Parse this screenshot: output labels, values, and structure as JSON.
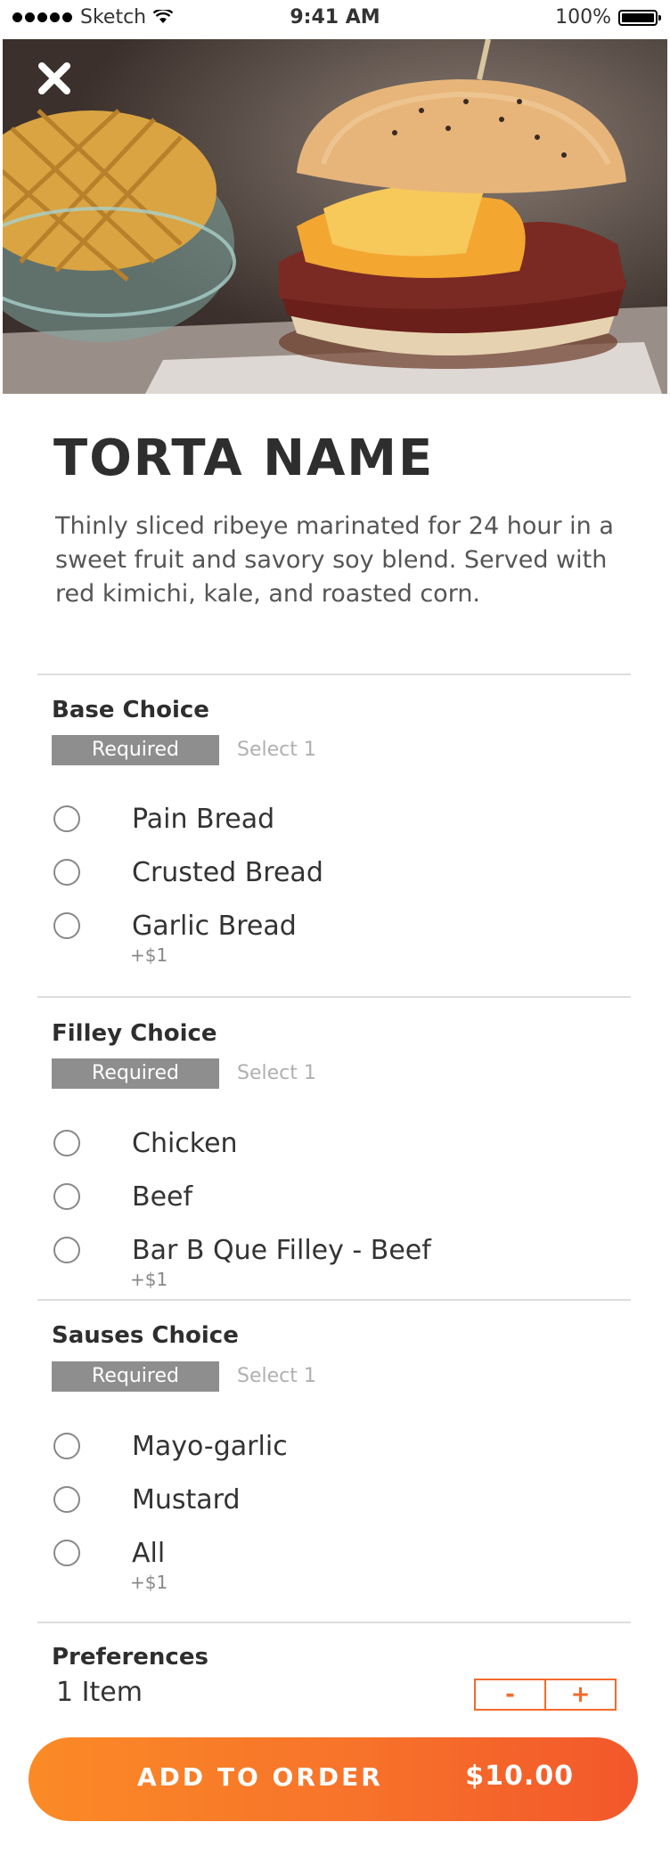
{
  "status_bar": {
    "carrier": "Sketch",
    "time": "9:41 AM",
    "battery": "100%"
  },
  "item": {
    "title": "TORTA NAME",
    "description": "Thinly sliced ribeye marinated for 24 hour in a sweet fruit and savory soy blend. Served with red kimichi, kale, and roasted corn."
  },
  "groups": [
    {
      "title": "Base Choice",
      "badge": "Required",
      "hint": "Select 1",
      "options": [
        {
          "label": "Pain Bread"
        },
        {
          "label": "Crusted Bread"
        },
        {
          "label": "Garlic Bread",
          "price": "+$1"
        }
      ]
    },
    {
      "title": "Filley Choice",
      "badge": "Required",
      "hint": "Select 1",
      "options": [
        {
          "label": "Chicken"
        },
        {
          "label": "Beef"
        },
        {
          "label": "Bar B Que Filley - Beef",
          "price": "+$1"
        }
      ]
    },
    {
      "title": "Sauses Choice",
      "badge": "Required",
      "hint": "Select 1",
      "options": [
        {
          "label": "Mayo-garlic"
        },
        {
          "label": "Mustard"
        },
        {
          "label": "All",
          "price": "+$1"
        }
      ]
    }
  ],
  "preferences": {
    "title": "Preferences",
    "quantity": "1 Item",
    "minus": "-",
    "plus": "+"
  },
  "order": {
    "label": "ADD TO ORDER",
    "price": "$10.00"
  },
  "colors": {
    "accent": "#f46a2b",
    "badge": "#8e8e8e"
  },
  "icons": {
    "close": "close-icon",
    "wifi": "wifi-icon",
    "battery": "battery-icon"
  }
}
